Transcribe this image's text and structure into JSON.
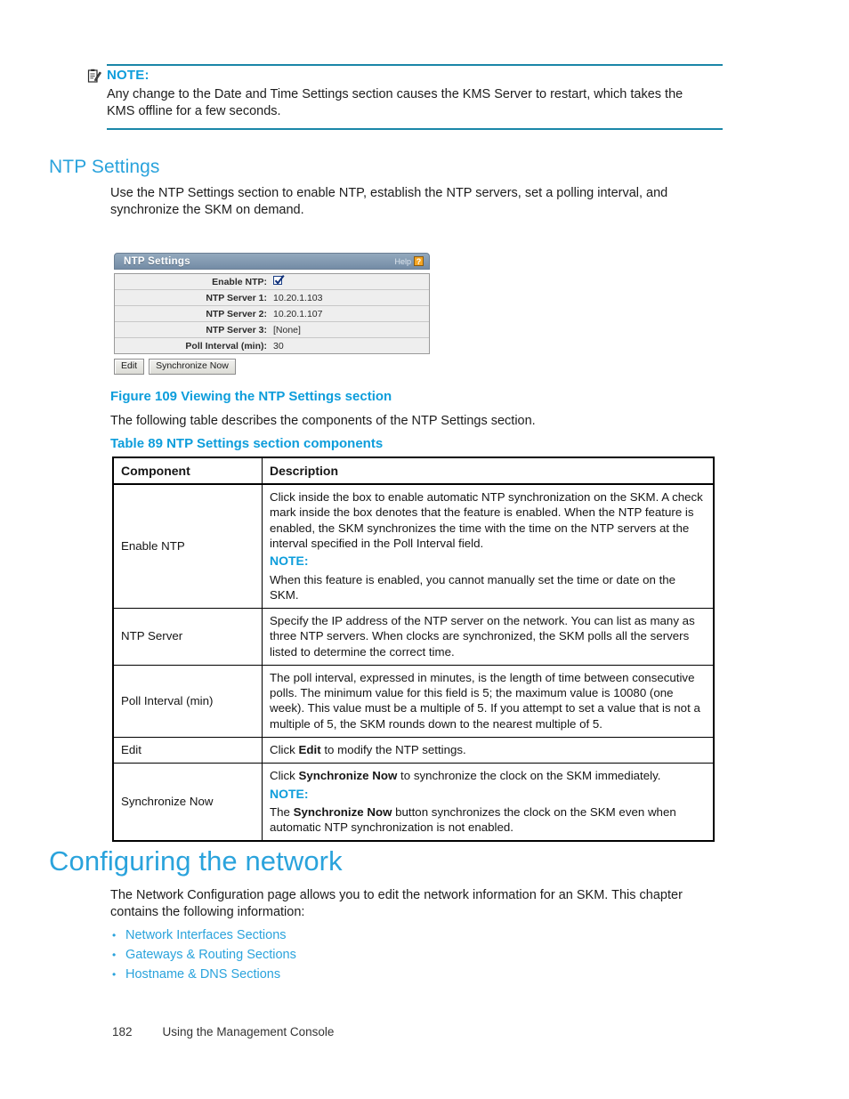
{
  "note_top": {
    "icon": "note-clipboard-icon",
    "label": "NOTE:",
    "body": "Any change to the Date and Time Settings section causes the KMS Server to restart, which takes the KMS offline for a few seconds."
  },
  "section": {
    "heading": "NTP Settings",
    "intro": "Use the NTP Settings section to enable NTP, establish the NTP servers, set a polling interval, and synchronize the SKM on demand."
  },
  "ntp_panel": {
    "title": "NTP Settings",
    "help_label": "Help",
    "help_icon": "question-mark-icon",
    "rows": [
      {
        "label": "Enable NTP:",
        "value": "",
        "type": "checkbox",
        "checked": true
      },
      {
        "label": "NTP Server 1:",
        "value": "10.20.1.103",
        "type": "text"
      },
      {
        "label": "NTP Server 2:",
        "value": "10.20.1.107",
        "type": "text"
      },
      {
        "label": "NTP Server 3:",
        "value": "[None]",
        "type": "text"
      },
      {
        "label": "Poll Interval (min):",
        "value": "30",
        "type": "text"
      }
    ],
    "buttons": [
      {
        "label": "Edit"
      },
      {
        "label": "Synchronize Now"
      }
    ]
  },
  "figure": {
    "caption": "Figure 109 Viewing the NTP Settings section",
    "after_text": "The following table describes the components of the NTP Settings section."
  },
  "table": {
    "caption": "Table 89 NTP Settings section components",
    "headers": [
      "Component",
      "Description"
    ],
    "rows": [
      {
        "component": "Enable NTP",
        "desc_before": "Click inside the box to enable automatic NTP synchronization on the SKM. A check mark inside the box denotes that the feature is enabled.  When the NTP feature is enabled, the SKM synchronizes the time with the time on the NTP servers at the interval specified in the Poll Interval field.",
        "note_label": "NOTE:",
        "desc_after": "When this feature is enabled, you cannot manually set the time or date on the SKM."
      },
      {
        "component": "NTP Server",
        "desc_before": "Specify the IP address of the NTP server on the network.  You can list as many as three NTP servers. When clocks are synchronized, the SKM polls all the servers listed to determine the correct time.",
        "note_label": "",
        "desc_after": ""
      },
      {
        "component": "Poll Interval (min)",
        "desc_before": "The poll interval, expressed in minutes, is the length of time between consecutive polls. The minimum value for this field is 5; the maximum value is 10080 (one week). This value must be a multiple of 5. If you attempt to set a value that is not a multiple of 5, the SKM rounds down to the nearest multiple of 5.",
        "note_label": "",
        "desc_after": ""
      },
      {
        "component": "Edit",
        "desc_before_parts": [
          "Click ",
          "Edit",
          " to modify the NTP settings."
        ],
        "note_label": "",
        "desc_after": ""
      },
      {
        "component": "Synchronize Now",
        "desc_before_parts": [
          "Click ",
          "Synchronize Now",
          " to synchronize the clock on the SKM immediately."
        ],
        "note_label": "NOTE:",
        "desc_after_parts": [
          "The ",
          "Synchronize Now",
          " button synchronizes the clock on the SKM even when automatic NTP synchronization is not enabled."
        ]
      }
    ]
  },
  "chapter": {
    "heading": "Configuring the network",
    "intro": "The Network Configuration page allows you to edit the network information for an SKM. This chapter contains the following information:",
    "links": [
      "Network Interfaces Sections",
      "Gateways & Routing Sections",
      "Hostname & DNS Sections"
    ]
  },
  "footer": {
    "page_number": "182",
    "running_title": "Using the Management Console"
  },
  "colors": {
    "link_blue": "#2aa3dc",
    "heading_blue": "#0d9ddb",
    "rule_teal": "#1a86a8",
    "panel_header": "#748ca6",
    "help_orange": "#f5a623"
  }
}
